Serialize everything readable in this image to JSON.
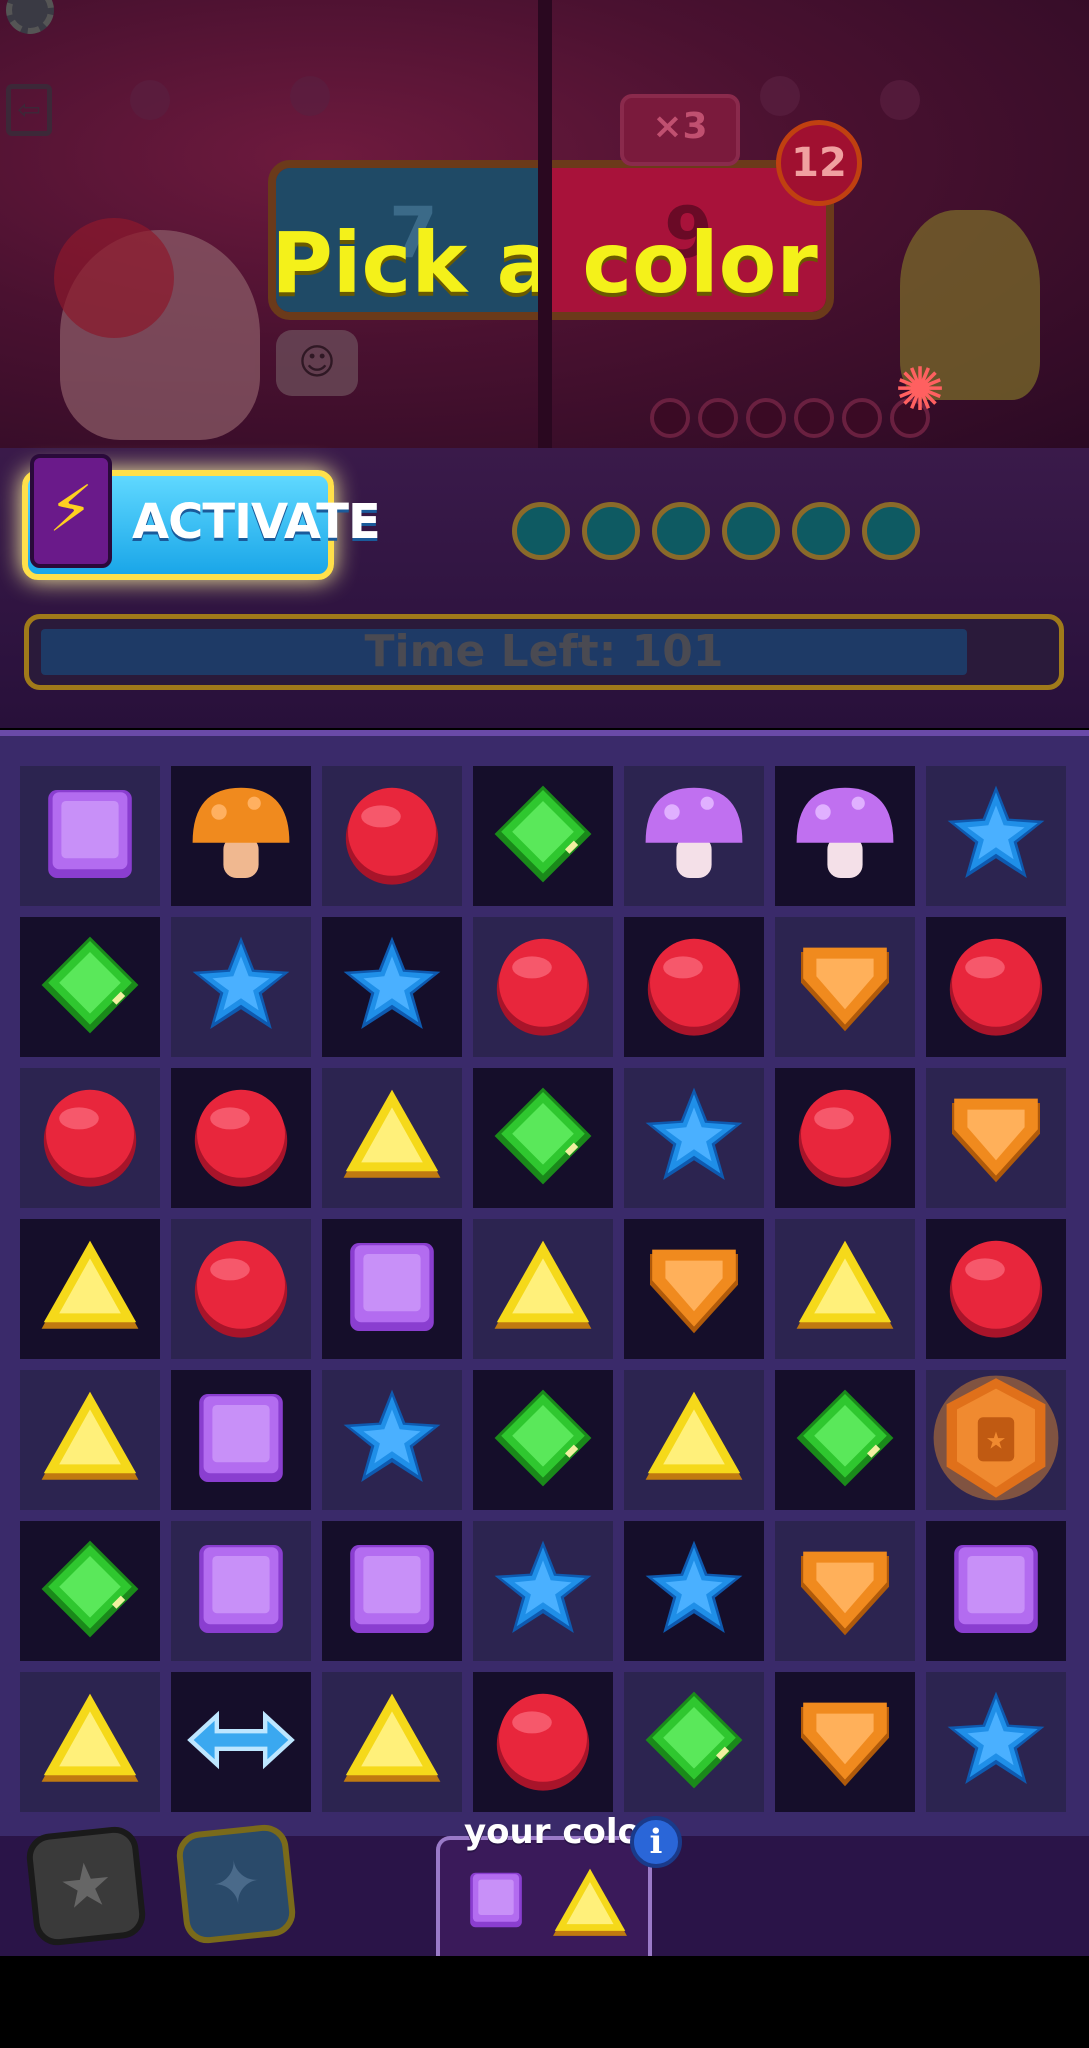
{
  "screen": {
    "prompt": "Pick a color",
    "left_score": "7",
    "right_score": "9",
    "multiplier": "×3",
    "turns_left": "12"
  },
  "activate_button": {
    "label": "ACTIVATE"
  },
  "timer": {
    "label": "Time Left: 101",
    "fill_fraction": 0.92
  },
  "board": {
    "rows": [
      [
        "purple-square",
        "orange-mushroom",
        "red-circle",
        "green-diamond",
        "purple-mushroom",
        "purple-mushroom",
        "blue-star"
      ],
      [
        "green-diamond",
        "blue-star",
        "blue-star",
        "red-circle",
        "red-circle",
        "orange-shield",
        "red-circle"
      ],
      [
        "red-circle",
        "red-circle",
        "yellow-triangle",
        "green-diamond",
        "blue-star",
        "red-circle",
        "orange-shield"
      ],
      [
        "yellow-triangle",
        "red-circle",
        "purple-square",
        "yellow-triangle",
        "orange-shield",
        "yellow-triangle",
        "red-circle"
      ],
      [
        "yellow-triangle",
        "purple-square",
        "blue-star",
        "green-diamond",
        "yellow-triangle",
        "green-diamond",
        "orange-badge"
      ],
      [
        "green-diamond",
        "purple-square",
        "purple-square",
        "blue-star",
        "blue-star",
        "orange-shield",
        "purple-square"
      ],
      [
        "yellow-triangle",
        "swap-arrow",
        "yellow-triangle",
        "red-circle",
        "green-diamond",
        "orange-shield",
        "blue-star"
      ]
    ]
  },
  "your_colors": {
    "label": "your colors",
    "info_icon": "i",
    "items": [
      "purple-square",
      "yellow-triangle"
    ]
  },
  "colors": {
    "purple": "#b36cf0",
    "orange": "#f08a1e",
    "red": "#e8263c",
    "green": "#2fc72f",
    "blue": "#1f8fe8",
    "yellow": "#f5d91a",
    "accent_yellow": "#f4f11a"
  }
}
